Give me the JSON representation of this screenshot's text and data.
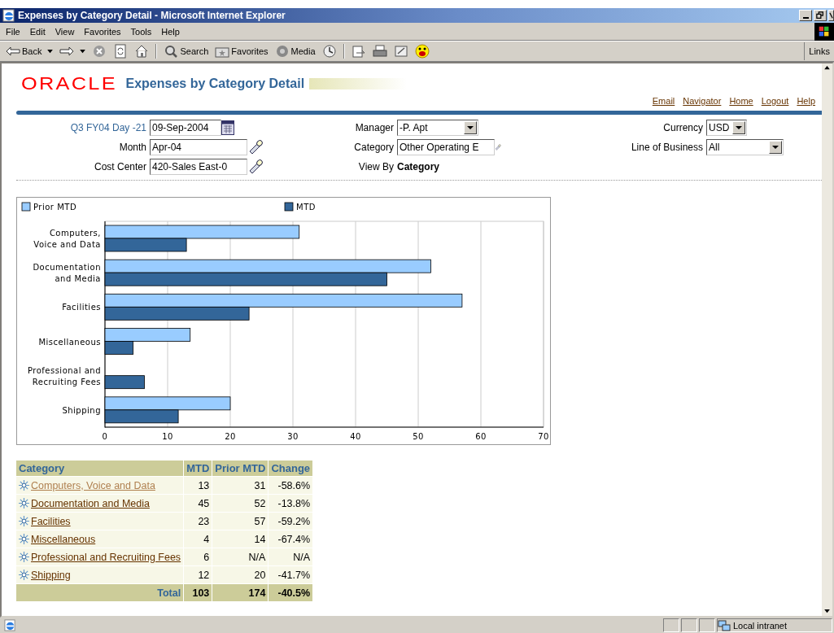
{
  "window": {
    "title": "Expenses by Category Detail - Microsoft Internet Explorer"
  },
  "menu": [
    {
      "label": "File"
    },
    {
      "label": "Edit"
    },
    {
      "label": "View"
    },
    {
      "label": "Favorites"
    },
    {
      "label": "Tools"
    },
    {
      "label": "Help"
    }
  ],
  "toolbar": [
    {
      "kind": "back",
      "label": "Back"
    },
    {
      "kind": "forward"
    },
    {
      "kind": "stop"
    },
    {
      "kind": "refresh"
    },
    {
      "kind": "home"
    },
    {
      "kind": "separator"
    },
    {
      "kind": "search",
      "label": "Search"
    },
    {
      "kind": "favorites",
      "label": "Favorites"
    },
    {
      "kind": "media",
      "label": "Media"
    },
    {
      "kind": "history"
    },
    {
      "kind": "separator"
    },
    {
      "kind": "mail"
    },
    {
      "kind": "print"
    },
    {
      "kind": "edit"
    },
    {
      "kind": "messenger"
    }
  ],
  "links_label": "Links",
  "header": {
    "logo": "ORACLE",
    "title": "Expenses by Category Detail",
    "global_links": [
      "Email",
      "Navigator",
      "Home",
      "Logout",
      "Help"
    ]
  },
  "parameters": [
    {
      "kind": "date",
      "label": "Q3 FY04 Day -21",
      "value": "09-Sep-2004"
    },
    {
      "kind": "select",
      "label": "Manager",
      "value": "-P. Apt"
    },
    {
      "kind": "select",
      "label": "Currency",
      "value": "USD"
    },
    {
      "kind": "lov",
      "label": "Month",
      "value": "Apr-04"
    },
    {
      "kind": "lov",
      "label": "Category",
      "value": "Other Operating E"
    },
    {
      "kind": "select",
      "label": "Line of Business",
      "value": "All"
    },
    {
      "kind": "lov",
      "label": "Cost Center",
      "value": "420-Sales East-0"
    },
    {
      "kind": "static",
      "label": "View By",
      "value": "Category"
    }
  ],
  "chart_data": {
    "type": "bar",
    "orientation": "horizontal",
    "categories": [
      "Computers, Voice and Data",
      "Documentation and Media",
      "Facilities",
      "Miscellaneous",
      "Professional and Recruiting Fees",
      "Shipping"
    ],
    "series": [
      {
        "name": "Prior MTD",
        "color": "#99ccff",
        "values": [
          31,
          52,
          57,
          13.6,
          null,
          20
        ]
      },
      {
        "name": "MTD",
        "color": "#336699",
        "values": [
          13,
          45,
          23,
          4.5,
          6.3,
          11.7
        ]
      }
    ],
    "xlim": [
      0,
      70
    ],
    "grid": true,
    "legend": true,
    "xticks": [
      0,
      10,
      20,
      30,
      40,
      50,
      60,
      70
    ]
  },
  "table": {
    "columns": [
      "Category",
      "MTD",
      "Prior MTD",
      "Change"
    ],
    "rows": [
      {
        "category": "Computers, Voice and Data",
        "visited": true,
        "mtd": "13",
        "prior_mtd": "31",
        "change": "-58.6%"
      },
      {
        "category": "Documentation and Media",
        "visited": false,
        "mtd": "45",
        "prior_mtd": "52",
        "change": "-13.8%"
      },
      {
        "category": "Facilities",
        "visited": false,
        "mtd": "23",
        "prior_mtd": "57",
        "change": "-59.2%"
      },
      {
        "category": "Miscellaneous",
        "visited": false,
        "mtd": "4",
        "prior_mtd": "14",
        "change": "-67.4%"
      },
      {
        "category": "Professional and Recruiting Fees",
        "visited": false,
        "mtd": "6",
        "prior_mtd": "N/A",
        "change": "N/A"
      },
      {
        "category": "Shipping",
        "visited": false,
        "mtd": "12",
        "prior_mtd": "20",
        "change": "-41.7%"
      }
    ],
    "total": {
      "label": "Total",
      "mtd": "103",
      "prior_mtd": "174",
      "change": "-40.5%"
    }
  },
  "status_bar": {
    "zone": "Local intranet"
  }
}
